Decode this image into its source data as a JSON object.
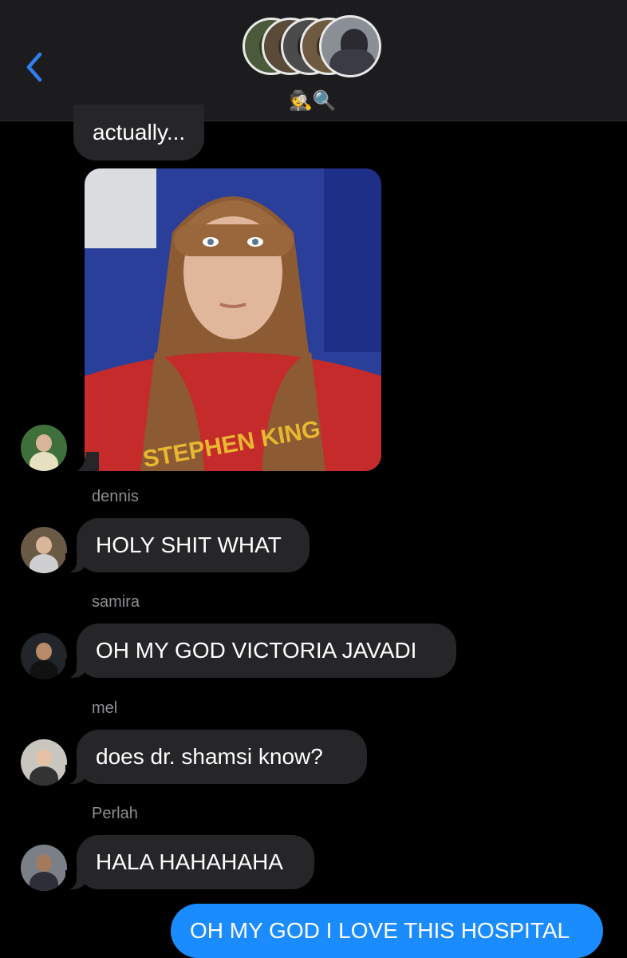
{
  "header": {
    "back_icon": "chevron-left-icon",
    "group_emoji": "🕵🔍",
    "accent": "#2f80ed"
  },
  "messages": [
    {
      "sender": "",
      "text": "actually..."
    },
    {
      "sender": "",
      "type": "photo",
      "caption": "STEPHEN KING"
    },
    {
      "sender": "dennis",
      "text": "HOLY SHIT WHAT"
    },
    {
      "sender": "samira",
      "text": "OH MY GOD VICTORIA JAVADI"
    },
    {
      "sender": "mel",
      "text": "does dr. shamsi know?"
    },
    {
      "sender": "Perlah",
      "text": "HALA HAHAHAHA"
    }
  ],
  "outgoing": {
    "text": "OH MY GOD I LOVE THIS HOSPITAL",
    "color": "#1b8cff"
  }
}
